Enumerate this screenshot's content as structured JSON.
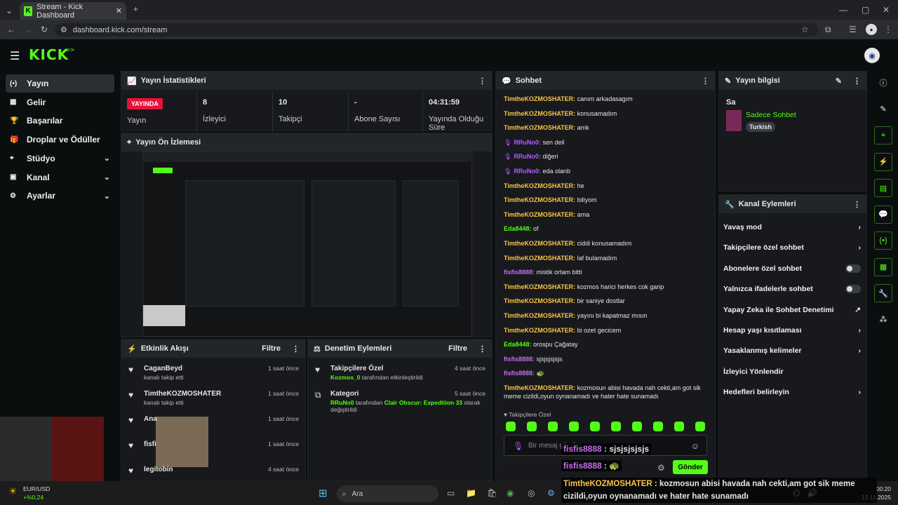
{
  "browser": {
    "tab_title": "Stream - Kick Dashboard",
    "url": "dashboard.kick.com/stream"
  },
  "brand": {
    "logo": "KICK",
    "beta": "BETA",
    "accent": "#53fc18"
  },
  "sidebar": {
    "items": [
      {
        "label": "Yayın",
        "selected": true,
        "icon": "broadcast-icon"
      },
      {
        "label": "Gelir",
        "icon": "revenue-icon"
      },
      {
        "label": "Başarılar",
        "icon": "trophy-icon"
      },
      {
        "label": "Droplar ve Ödüller",
        "icon": "gift-icon"
      },
      {
        "label": "Stüdyo",
        "chevron": true,
        "icon": "studio-icon"
      },
      {
        "label": "Kanal",
        "chevron": true,
        "icon": "channel-icon"
      },
      {
        "label": "Ayarlar",
        "chevron": true,
        "icon": "settings-icon"
      }
    ]
  },
  "stats": {
    "title": "Yayın İstatistikleri",
    "live_badge": "YAYINDA",
    "live_label": "Yayın",
    "viewers": {
      "value": "8",
      "label": "İzleyici"
    },
    "followers": {
      "value": "10",
      "label": "Takipçi"
    },
    "subs": {
      "value": "-",
      "label": "Abone Sayısı"
    },
    "uptime": {
      "value": "04:31:59",
      "label": "Yayında Olduğu Süre"
    }
  },
  "preview": {
    "title": "Yayın Ön İzlemesi"
  },
  "activity": {
    "title": "Etkinlik Akışı",
    "filter": "Filtre",
    "items": [
      {
        "name": "CaganBeyd",
        "sub": "kanalı takip etti",
        "time": "1 saat önce"
      },
      {
        "name": "TimtheKOZMOSHATER",
        "sub": "kanalı takip etti",
        "time": "1 saat önce"
      },
      {
        "name": "Ana",
        "sub": "",
        "time": "1 saat önce"
      },
      {
        "name": "fisfi",
        "sub": "",
        "time": "1 saat önce"
      },
      {
        "name": "legitobin",
        "sub": "",
        "time": "4 saat önce"
      }
    ]
  },
  "moderation": {
    "title": "Denetim Eylemleri",
    "filter": "Filtre",
    "items": [
      {
        "title": "Takipçilere Özel",
        "actor": "Kozmos_0",
        "text": "tarafından etkinleştirildi",
        "time": "4 saat önce"
      },
      {
        "title": "Kategori",
        "actor": "RRuNo0",
        "text": "tarafından",
        "game": "Clair Obscur: Expedition 33",
        "text2": "olarak değiştirildi",
        "time": "5 saat önce"
      }
    ]
  },
  "chat": {
    "title": "Sohbet",
    "messages": [
      {
        "user": "TimtheKOZMOSHATER",
        "c": "t",
        "text": "canım arkadasagım"
      },
      {
        "user": "TimtheKOZMOSHATER",
        "c": "t",
        "text": "konusamadım"
      },
      {
        "user": "TimtheKOZMOSHATER",
        "c": "t",
        "text": "amk"
      },
      {
        "user": "RRuNo0",
        "c": "r",
        "mic": true,
        "text": "sen deil"
      },
      {
        "user": "RRuNo0",
        "c": "r",
        "mic": true,
        "text": "diğeri"
      },
      {
        "user": "RRuNo0",
        "c": "r",
        "mic": true,
        "text": "eda olanb"
      },
      {
        "user": "TimtheKOZMOSHATER",
        "c": "t",
        "text": "he"
      },
      {
        "user": "TimtheKOZMOSHATER",
        "c": "t",
        "text": "biliyom"
      },
      {
        "user": "TimtheKOZMOSHATER",
        "c": "t",
        "text": "ama"
      },
      {
        "user": "Eda8448",
        "c": "e",
        "text": "of"
      },
      {
        "user": "TimtheKOZMOSHATER",
        "c": "t",
        "text": "ciddi konusamadım"
      },
      {
        "user": "TimtheKOZMOSHATER",
        "c": "t",
        "text": "laf bulamadım"
      },
      {
        "user": "fisfis8888",
        "c": "f",
        "text": "mistik ortam bitti"
      },
      {
        "user": "TimtheKOZMOSHATER",
        "c": "t",
        "text": "kozmos harici herkes cok garip"
      },
      {
        "user": "TimtheKOZMOSHATER",
        "c": "t",
        "text": "bir saniye dostlar"
      },
      {
        "user": "TimtheKOZMOSHATER",
        "c": "t",
        "text": "yayını bi kapatmaz mısın"
      },
      {
        "user": "TimtheKOZMOSHATER",
        "c": "t",
        "text": "bi ozet gecicem"
      },
      {
        "user": "Eda8448",
        "c": "e",
        "text": "orospu Çağatay"
      },
      {
        "user": "fisfis8888",
        "c": "f",
        "text": "sjsjsjsjsjs"
      },
      {
        "user": "fisfis8888",
        "c": "f",
        "text": "🐢"
      },
      {
        "user": "TimtheKOZMOSHATER",
        "c": "t",
        "text": "kozmosun abisi havada nah cekti,am got sik meme cizildi,oyun oynanamadı ve hater hate sunamadı"
      }
    ],
    "followers_only": "Takipçilere Özel",
    "placeholder": "Bir mesaj gönder",
    "send": "Gönder"
  },
  "overlay": {
    "lines": [
      {
        "user": "fisfis8888",
        "text": "sjsjsjsjsjs"
      },
      {
        "user": "fisfis8888",
        "text": "🐢"
      },
      {
        "user": "TimtheKOZMOSHATER",
        "text": "kozmosun abisi havada nah cekti,am got sik meme cizildi,oyun oynanamadı ve hater hate sunamadı"
      }
    ]
  },
  "info": {
    "title": "Yayın bilgisi",
    "stream_title": "Sa",
    "category": "Sadece Sohbet",
    "tag": "Turkish"
  },
  "actions": {
    "title": "Kanal Eylemleri",
    "items": [
      {
        "label": "Yavaş mod",
        "kind": "arrow"
      },
      {
        "label": "Takipçilere özel sohbet",
        "kind": "arrow"
      },
      {
        "label": "Abonelere özel sohbet",
        "kind": "toggle"
      },
      {
        "label": "Yalnızca ifadelerle sohbet",
        "kind": "toggle"
      },
      {
        "label": "Yapay Zeka ile Sohbet Denetimi",
        "kind": "external"
      },
      {
        "label": "Hesap yaşı kısıtlaması",
        "kind": "arrow"
      },
      {
        "label": "Yasaklanmış kelimeler",
        "kind": "arrow"
      },
      {
        "label": "İzleyici Yönlendir",
        "kind": "none"
      },
      {
        "label": "Hedefleri belirleyin",
        "kind": "arrow"
      }
    ]
  },
  "taskbar": {
    "ticker": "EUR/USD",
    "change": "+%0,24",
    "search": "Ara",
    "time": "00:20",
    "date": "12.11.2025"
  }
}
